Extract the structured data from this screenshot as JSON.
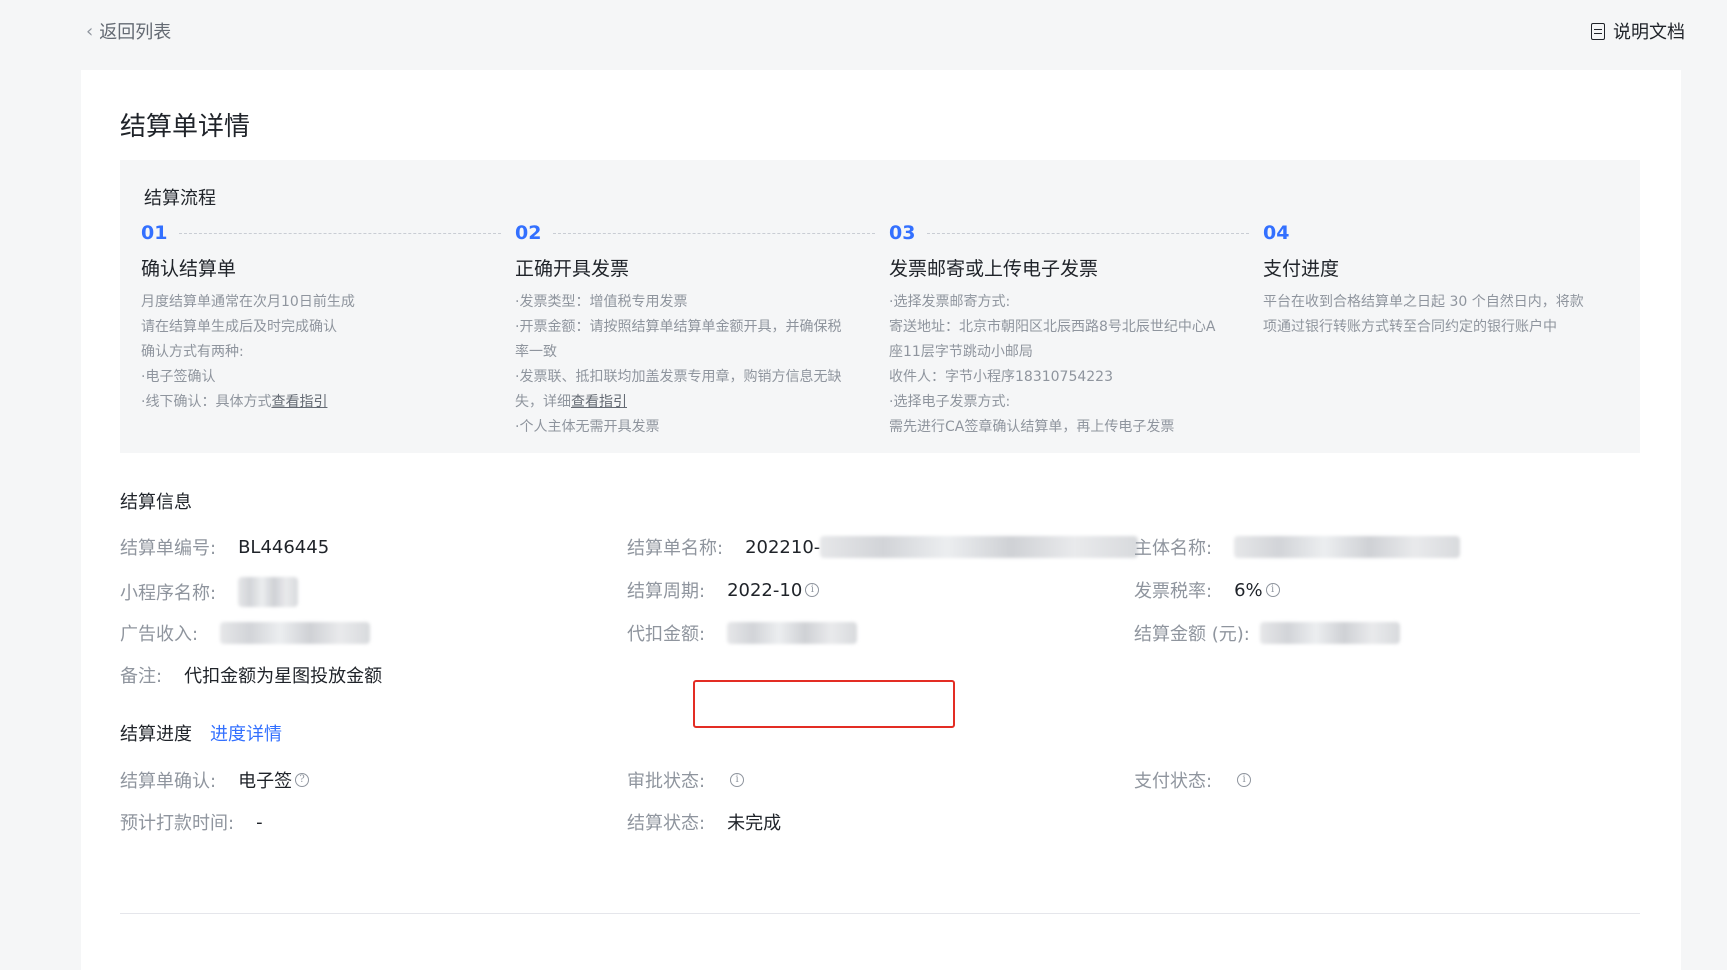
{
  "header": {
    "back_label": "返回列表",
    "docs_label": "说明文档"
  },
  "page_title": "结算单详情",
  "flow": {
    "title": "结算流程",
    "steps": [
      {
        "num": "01",
        "title": "确认结算单",
        "lines": [
          "月度结算单通常在次月10日前生成",
          "请在结算单生成后及时完成确认",
          "确认方式有两种:",
          "·电子签确认",
          "·线下确认：具体方式"
        ],
        "link": "查看指引"
      },
      {
        "num": "02",
        "title": "正确开具发票",
        "lines": [
          "·发票类型：增值税专用发票",
          "·开票金额：请按照结算单结算单金额开具，并确保税",
          "率一致",
          "·发票联、抵扣联均加盖发票专用章，购销方信息无缺",
          "失，详细",
          "·个人主体无需开具发票"
        ],
        "link": "查看指引"
      },
      {
        "num": "03",
        "title": "发票邮寄或上传电子发票",
        "lines": [
          "·选择发票邮寄方式:",
          "寄送地址：北京市朝阳区北辰西路8号北辰世纪中心A",
          "座11层字节跳动小邮局",
          "收件人：字节小程序18310754223",
          "·选择电子发票方式:",
          "需先进行CA签章确认结算单，再上传电子发票"
        ]
      },
      {
        "num": "04",
        "title": "支付进度",
        "lines": [
          "平台在收到合格结算单之日起 30 个自然日内，将款",
          "项通过银行转账方式转至合同约定的银行账户中"
        ]
      }
    ]
  },
  "settlement_info": {
    "title": "结算信息",
    "order_no_label": "结算单编号:",
    "order_no": "BL446445",
    "order_name_label": "结算单名称:",
    "order_name_prefix": "202210-",
    "subject_label": "主体名称:",
    "miniapp_label": "小程序名称:",
    "period_label": "结算周期:",
    "period": "2022-10",
    "tax_rate_label": "发票税率:",
    "tax_rate": "6%",
    "ad_income_label": "广告收入:",
    "withheld_label": "代扣金额:",
    "amount_label": "结算金额 (元):",
    "remark_label": "备注:",
    "remark": "代扣金额为星图投放金额"
  },
  "progress": {
    "title": "结算进度",
    "detail_link": "进度详情",
    "confirm_label": "结算单确认:",
    "confirm_value": "电子签",
    "approval_label": "审批状态:",
    "pay_label": "支付状态:",
    "est_time_label": "预计打款时间:",
    "est_time": "-",
    "status_label": "结算状态:",
    "status": "未完成"
  }
}
